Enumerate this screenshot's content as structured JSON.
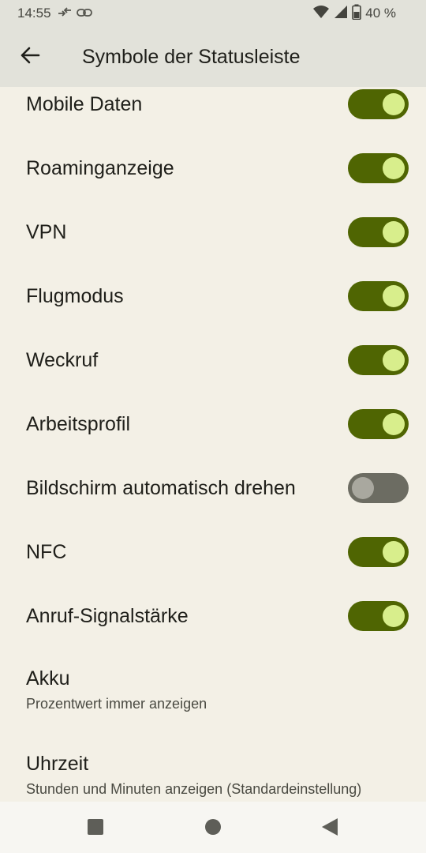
{
  "status_bar": {
    "time": "14:55",
    "battery_text": "40 %",
    "icons": [
      "data-transfer-icon",
      "link-icon",
      "wifi-icon",
      "signal-icon",
      "battery-icon"
    ]
  },
  "app_bar": {
    "title": "Symbole der Statusleiste",
    "back_icon": "arrow-back-icon"
  },
  "settings": [
    {
      "label": "Mobile Daten",
      "enabled": true
    },
    {
      "label": "Roaminganzeige",
      "enabled": true
    },
    {
      "label": "VPN",
      "enabled": true
    },
    {
      "label": "Flugmodus",
      "enabled": true
    },
    {
      "label": "Weckruf",
      "enabled": true
    },
    {
      "label": "Arbeitsprofil",
      "enabled": true
    },
    {
      "label": "Bildschirm automatisch drehen",
      "enabled": false
    },
    {
      "label": "NFC",
      "enabled": true
    },
    {
      "label": "Anruf-Signalstärke",
      "enabled": true
    }
  ],
  "options": [
    {
      "label": "Akku",
      "summary": "Prozentwert immer anzeigen"
    },
    {
      "label": "Uhrzeit",
      "summary": "Stunden und Minuten anzeigen (Standardeinstellung)"
    }
  ],
  "nav_bar": {
    "buttons": [
      "recents-square-icon",
      "home-circle-icon",
      "back-triangle-icon"
    ]
  },
  "colors": {
    "switch_on_track": "#4f6502",
    "switch_on_knob": "#d8ee8c",
    "switch_off_track": "#6c6c62",
    "switch_off_knob": "#a9a89f",
    "background": "#f3f0e6",
    "bar_background": "#e2e2da"
  }
}
